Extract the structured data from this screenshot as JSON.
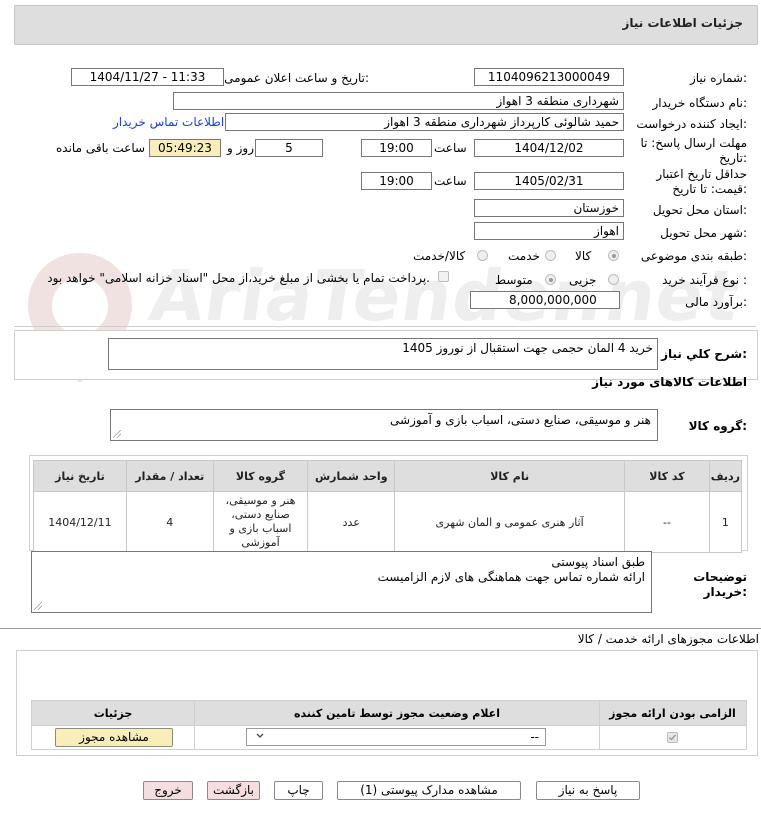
{
  "header": {
    "title": "جزئیات اطلاعات نیاز"
  },
  "watermark": {
    "text": "AriaTender.net"
  },
  "form": {
    "need_number_label": "شماره نیاز:",
    "need_number": "1104096213000049",
    "announce_label": "تاریخ و ساعت اعلان عمومی:",
    "announce_value": "1404/11/27 - 11:33",
    "buyer_org_label": "نام دستگاه خریدار:",
    "buyer_org": "شهرداری منطقه 3 اهواز",
    "creator_label": "ایجاد کننده درخواست:",
    "creator": "حمید شالوئی کارپرداز شهرداری منطقه 3 اهواز",
    "contact_link": "اطلاعات تماس خریدار",
    "deadline_label_1": "مهلت ارسال پاسخ: تا",
    "deadline_label_2": "تاریخ:",
    "deadline_date": "1404/12/02",
    "time_label": "ساعت",
    "deadline_time": "19:00",
    "days_value": "5",
    "days_label": "روز و",
    "remaining_time": "05:49:23",
    "remaining_label": "ساعت باقی مانده",
    "validity_label_1": "حداقل تاریخ اعتبار",
    "validity_label_2": "قیمت: تا تاریخ:",
    "validity_date": "1405/02/31",
    "validity_time": "19:00",
    "province_label": "استان محل تحویل:",
    "province": "خوزستان",
    "city_label": "شهر محل تحویل:",
    "city": "اهواز",
    "category_label": "طبقه بندی موضوعی:",
    "category_options": [
      "کالا",
      "خدمت",
      "کالا/خدمت"
    ],
    "category_selected": "کالا",
    "purchase_type_label": "نوع فرآیند خرید :",
    "purchase_options": [
      "جزیی",
      "متوسط"
    ],
    "purchase_selected": "متوسط",
    "payment_note": "پرداخت تمام یا بخشی از مبلغ خرید،از محل \"اسناد خزانه اسلامی\" خواهد بود.",
    "estimate_label": "برآورد مالی:",
    "estimate_value": "8,000,000,000"
  },
  "description": {
    "label": "شرح کلي نياز:",
    "value": "خرید 4 المان حجمی جهت استقبال از نوروز 1405"
  },
  "goods": {
    "section_title": "اطلاعات کالاهای مورد نیاز",
    "group_label": "گروه کالا:",
    "group_value": "هنر و موسیقی، صنایع دستی، اسباب بازی و آموزشی",
    "columns": [
      "ردیف",
      "کد کالا",
      "نام کالا",
      "واحد شمارش",
      "گروه کالا",
      "تعداد / مقدار",
      "تاریخ نیاز"
    ],
    "rows": [
      {
        "index": "1",
        "code": "--",
        "name": "آثار هنری عمومی و المان شهری",
        "unit": "عدد",
        "group": "هنر و موسیقی، صنایع دستی، اسباب بازی و آموزشی",
        "qty": "4",
        "date": "1404/12/11"
      }
    ]
  },
  "buyer_notes": {
    "label_1": "توضیحات",
    "label_2": "خریدار:",
    "line_1": "طبق اسناد پیوستی",
    "line_2": "ارائه شماره تماس جهت هماهنگی های لازم الزامیست"
  },
  "permits": {
    "section_title": "اطلاعات مجوزهای ارائه خدمت / کالا",
    "columns": [
      "الزامی بودن ارائه مجوز",
      "اعلام وضعیت مجوز توسط تامین کننده",
      "جزئیات"
    ],
    "select_value": "--",
    "view_button": "مشاهده مجوز"
  },
  "actions": {
    "reply": "پاسخ به نیاز",
    "attachments": "مشاهده مدارک پیوستی (1)",
    "print": "چاپ",
    "back": "بازگشت",
    "exit": "خروج"
  },
  "colors": {
    "header_bg": "#dedede",
    "yellow_field": "#f7eeba",
    "pink_button": "#f6dede",
    "link": "#1a3fd6"
  }
}
